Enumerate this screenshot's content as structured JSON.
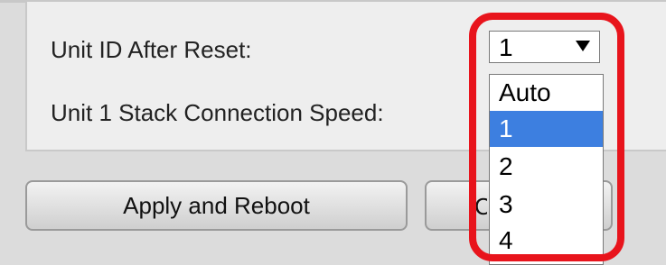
{
  "form": {
    "unit_id_label": "Unit ID After Reset:",
    "stack_speed_label": "Unit 1 Stack Connection Speed:"
  },
  "unit_id_select": {
    "value": "1",
    "options": [
      "Auto",
      "1",
      "2",
      "3",
      "4"
    ],
    "selected_index": 1
  },
  "buttons": {
    "apply_label": "Apply and Reboot",
    "cancel_visible_fragment": "C"
  },
  "colors": {
    "highlight": "#e8141c",
    "selected_option_bg": "#3d7fe0",
    "panel_bg": "#eeeeee",
    "page_bg": "#dcdcdc"
  },
  "icons": {
    "select_arrow": "dropdown-arrow-icon"
  }
}
